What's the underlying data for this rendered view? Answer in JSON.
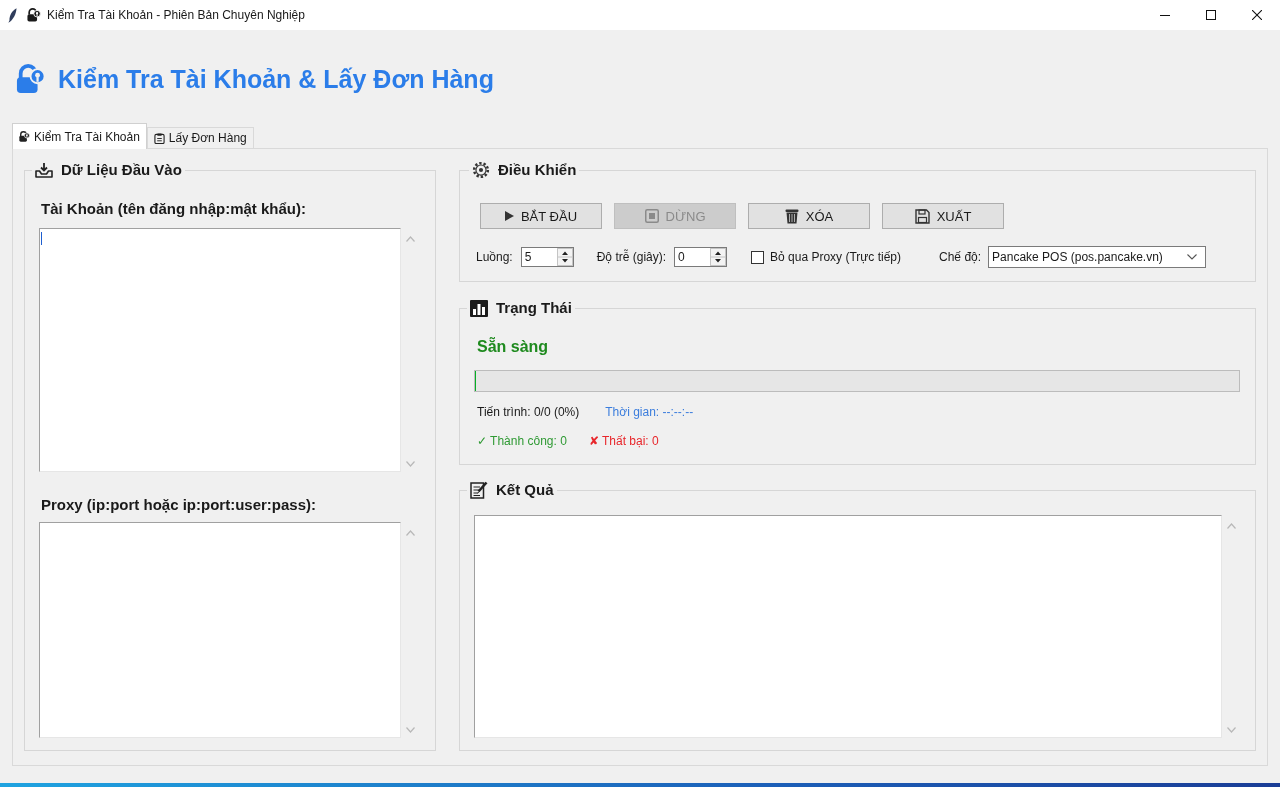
{
  "window": {
    "title": "Kiểm Tra Tài Khoản - Phiên Bản Chuyên Nghiệp"
  },
  "header": {
    "title": "Kiểm Tra Tài Khoản & Lấy Đơn Hàng"
  },
  "tabs": [
    {
      "label": "Kiểm Tra Tài Khoản",
      "selected": true
    },
    {
      "label": "Lấy Đơn Hàng",
      "selected": false
    }
  ],
  "input_panel": {
    "title": "Dữ Liệu Đầu Vào",
    "fields": [
      {
        "label": "Tài Khoản (tên đăng nhập:mật khẩu):",
        "focused": true
      },
      {
        "label": "Proxy (ip:port hoặc ip:port:user:pass):",
        "focused": false
      }
    ]
  },
  "controls": {
    "title": "Điều Khiển",
    "buttons": [
      {
        "label": "BẮT ĐẦU",
        "disabled": false
      },
      {
        "label": "DỪNG",
        "disabled": true
      },
      {
        "label": "XÓA",
        "disabled": false
      },
      {
        "label": "XUẤT",
        "disabled": false
      }
    ],
    "threads": {
      "label": "Luồng:",
      "value": "5"
    },
    "delay": {
      "label": "Độ trễ (giây):",
      "value": "0"
    },
    "skip_proxy": {
      "label": "Bỏ qua Proxy (Trực tiếp)",
      "checked": false
    },
    "mode": {
      "label": "Chế độ:",
      "value": "Pancake POS (pos.pancake.vn)"
    }
  },
  "status": {
    "title": "Trạng Thái",
    "state": "Sẵn sàng",
    "progress_bar": {
      "level": 0
    },
    "progress": "Tiến trình: 0/0 (0%)",
    "elapsed": "Thời gian: --:--:--",
    "success": "✓ Thành công: 0",
    "failed": "✘ Thất bại: 0"
  },
  "results": {
    "title": "Kết Quả"
  }
}
